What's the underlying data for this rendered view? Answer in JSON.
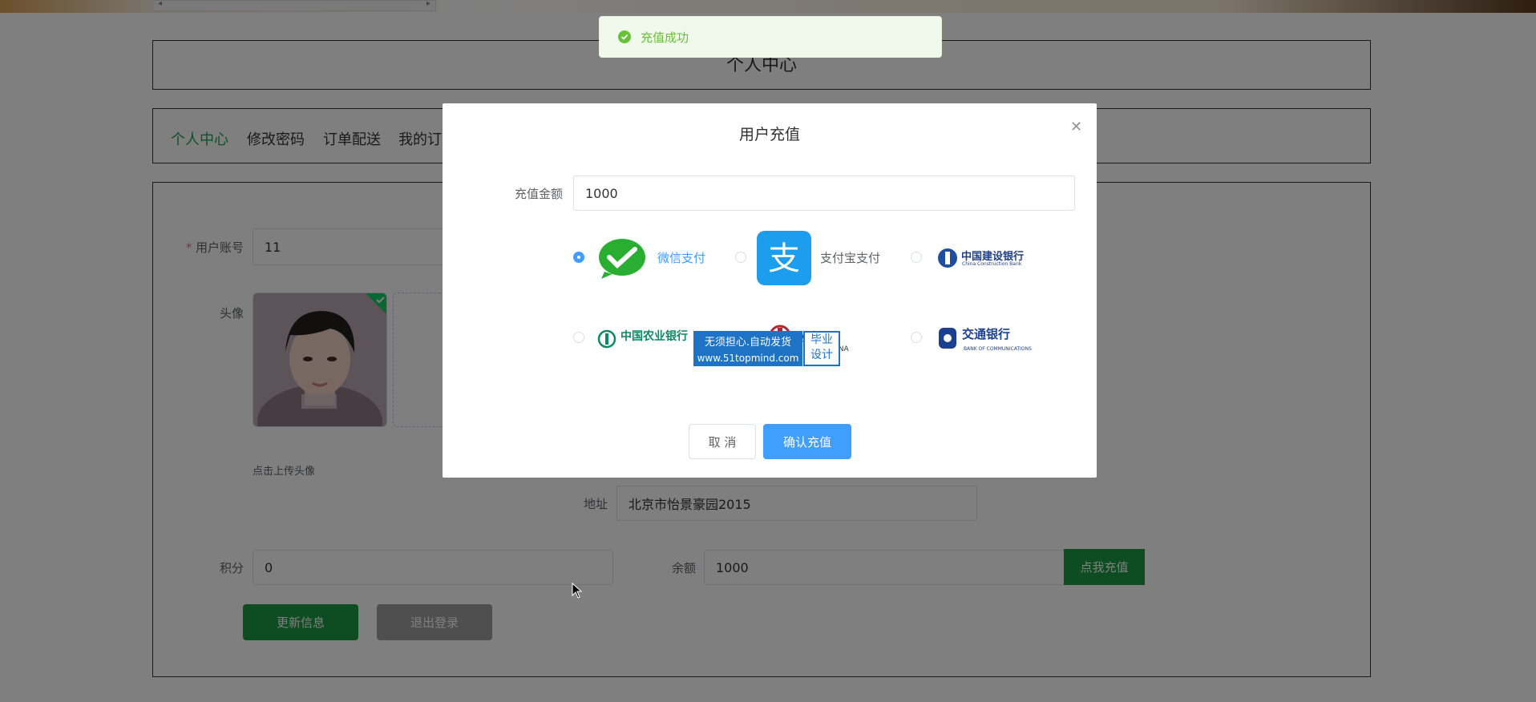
{
  "page": {
    "title": "个人中心",
    "nav": [
      "个人中心",
      "修改密码",
      "订单配送",
      "我的订"
    ]
  },
  "form": {
    "account_label": "用户账号",
    "account_required_mark": "*",
    "account_value": "11",
    "avatar_label": "头像",
    "upload_hint": "点击上传头像",
    "address_label": "地址",
    "address_value": "北京市怡景豪园2015",
    "points_label": "积分",
    "points_value": "0",
    "balance_label": "余额",
    "balance_value": "1000",
    "recharge_button": "点我充值",
    "update_button": "更新信息",
    "logout_button": "退出登录"
  },
  "toast": {
    "message": "充值成功"
  },
  "dialog": {
    "title": "用户充值",
    "amount_label": "充值金额",
    "amount_value": "1000",
    "payments": [
      {
        "name": "微信支付",
        "selected": true
      },
      {
        "name": "支付宝支付",
        "selected": false
      },
      {
        "name": "中国建设银行",
        "sub": "China Construction Bank",
        "selected": false
      },
      {
        "name": "中国农业银行",
        "selected": false
      },
      {
        "name": "银行",
        "sub": "CHINA",
        "selected": false
      },
      {
        "name": "交通银行",
        "sub": "BANK OF COMMUNICATIONS",
        "selected": false
      }
    ],
    "cancel_button": "取 消",
    "confirm_button": "确认充值"
  },
  "watermark": {
    "line1": "无须担心.自动发货",
    "line2": "www.51topmind.com",
    "right1": "毕业",
    "right2": "设计"
  },
  "colors": {
    "accent_green": "#1aa255",
    "button_green": "#1c9b45",
    "primary_blue": "#409eff",
    "success_green": "#67c23a"
  }
}
